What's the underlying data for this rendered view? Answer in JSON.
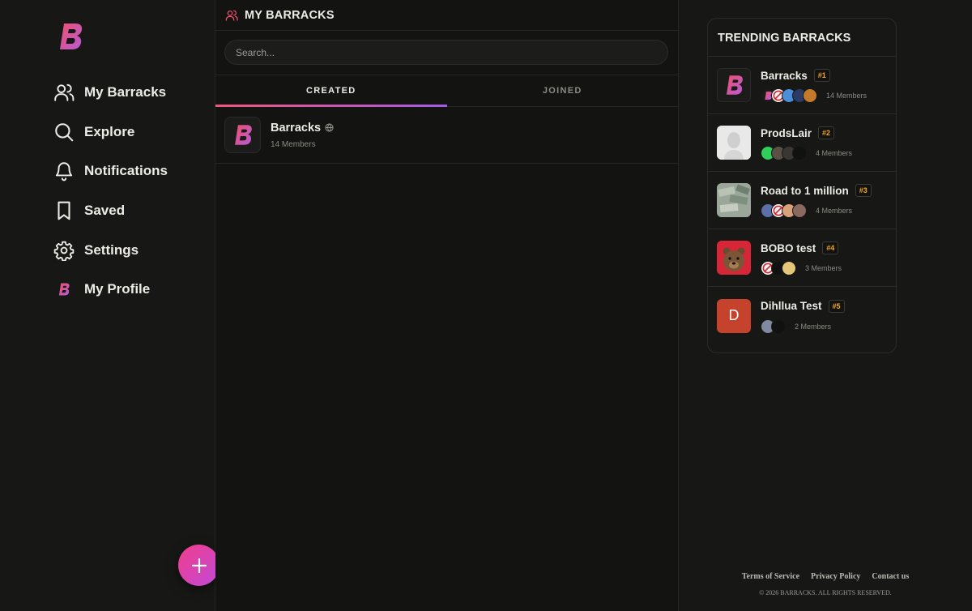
{
  "sidebar": {
    "logo_letter": "B",
    "items": [
      {
        "label": "My Barracks",
        "icon": "users-icon"
      },
      {
        "label": "Explore",
        "icon": "search-icon"
      },
      {
        "label": "Notifications",
        "icon": "bell-icon"
      },
      {
        "label": "Saved",
        "icon": "bookmark-icon"
      },
      {
        "label": "Settings",
        "icon": "gear-icon"
      },
      {
        "label": "My Profile",
        "icon": "brand-logo-icon"
      }
    ],
    "fab_icon": "plus-icon"
  },
  "main": {
    "title": "MY BARRACKS",
    "search_placeholder": "Search...",
    "tabs": [
      {
        "label": "CREATED",
        "active": true
      },
      {
        "label": "JOINED",
        "active": false
      }
    ],
    "items": [
      {
        "name": "Barracks",
        "members": "14 Members",
        "icon": "globe-icon"
      }
    ]
  },
  "trending": {
    "title": "TRENDING BARRACKS",
    "items": [
      {
        "name": "Barracks",
        "rank": "#1",
        "members": "14 Members"
      },
      {
        "name": "ProdsLair",
        "rank": "#2",
        "members": "4 Members"
      },
      {
        "name": "Road to 1 million",
        "rank": "#3",
        "members": "4 Members"
      },
      {
        "name": "BOBO test",
        "rank": "#4",
        "members": "3 Members"
      },
      {
        "name": "Dihllua Test",
        "rank": "#5",
        "members": "2 Members",
        "avatar_letter": "D"
      }
    ]
  },
  "footer": {
    "links": [
      "Terms of Service",
      "Privacy Policy",
      "Contact us"
    ],
    "copyright": "© 2026 BARRACKS. ALL RIGHTS RESERVED."
  },
  "colors": {
    "accent_pink": "#f23d8a",
    "accent_purple": "#a35ae6",
    "rank_orange": "#f5a623",
    "background": "#131411"
  }
}
